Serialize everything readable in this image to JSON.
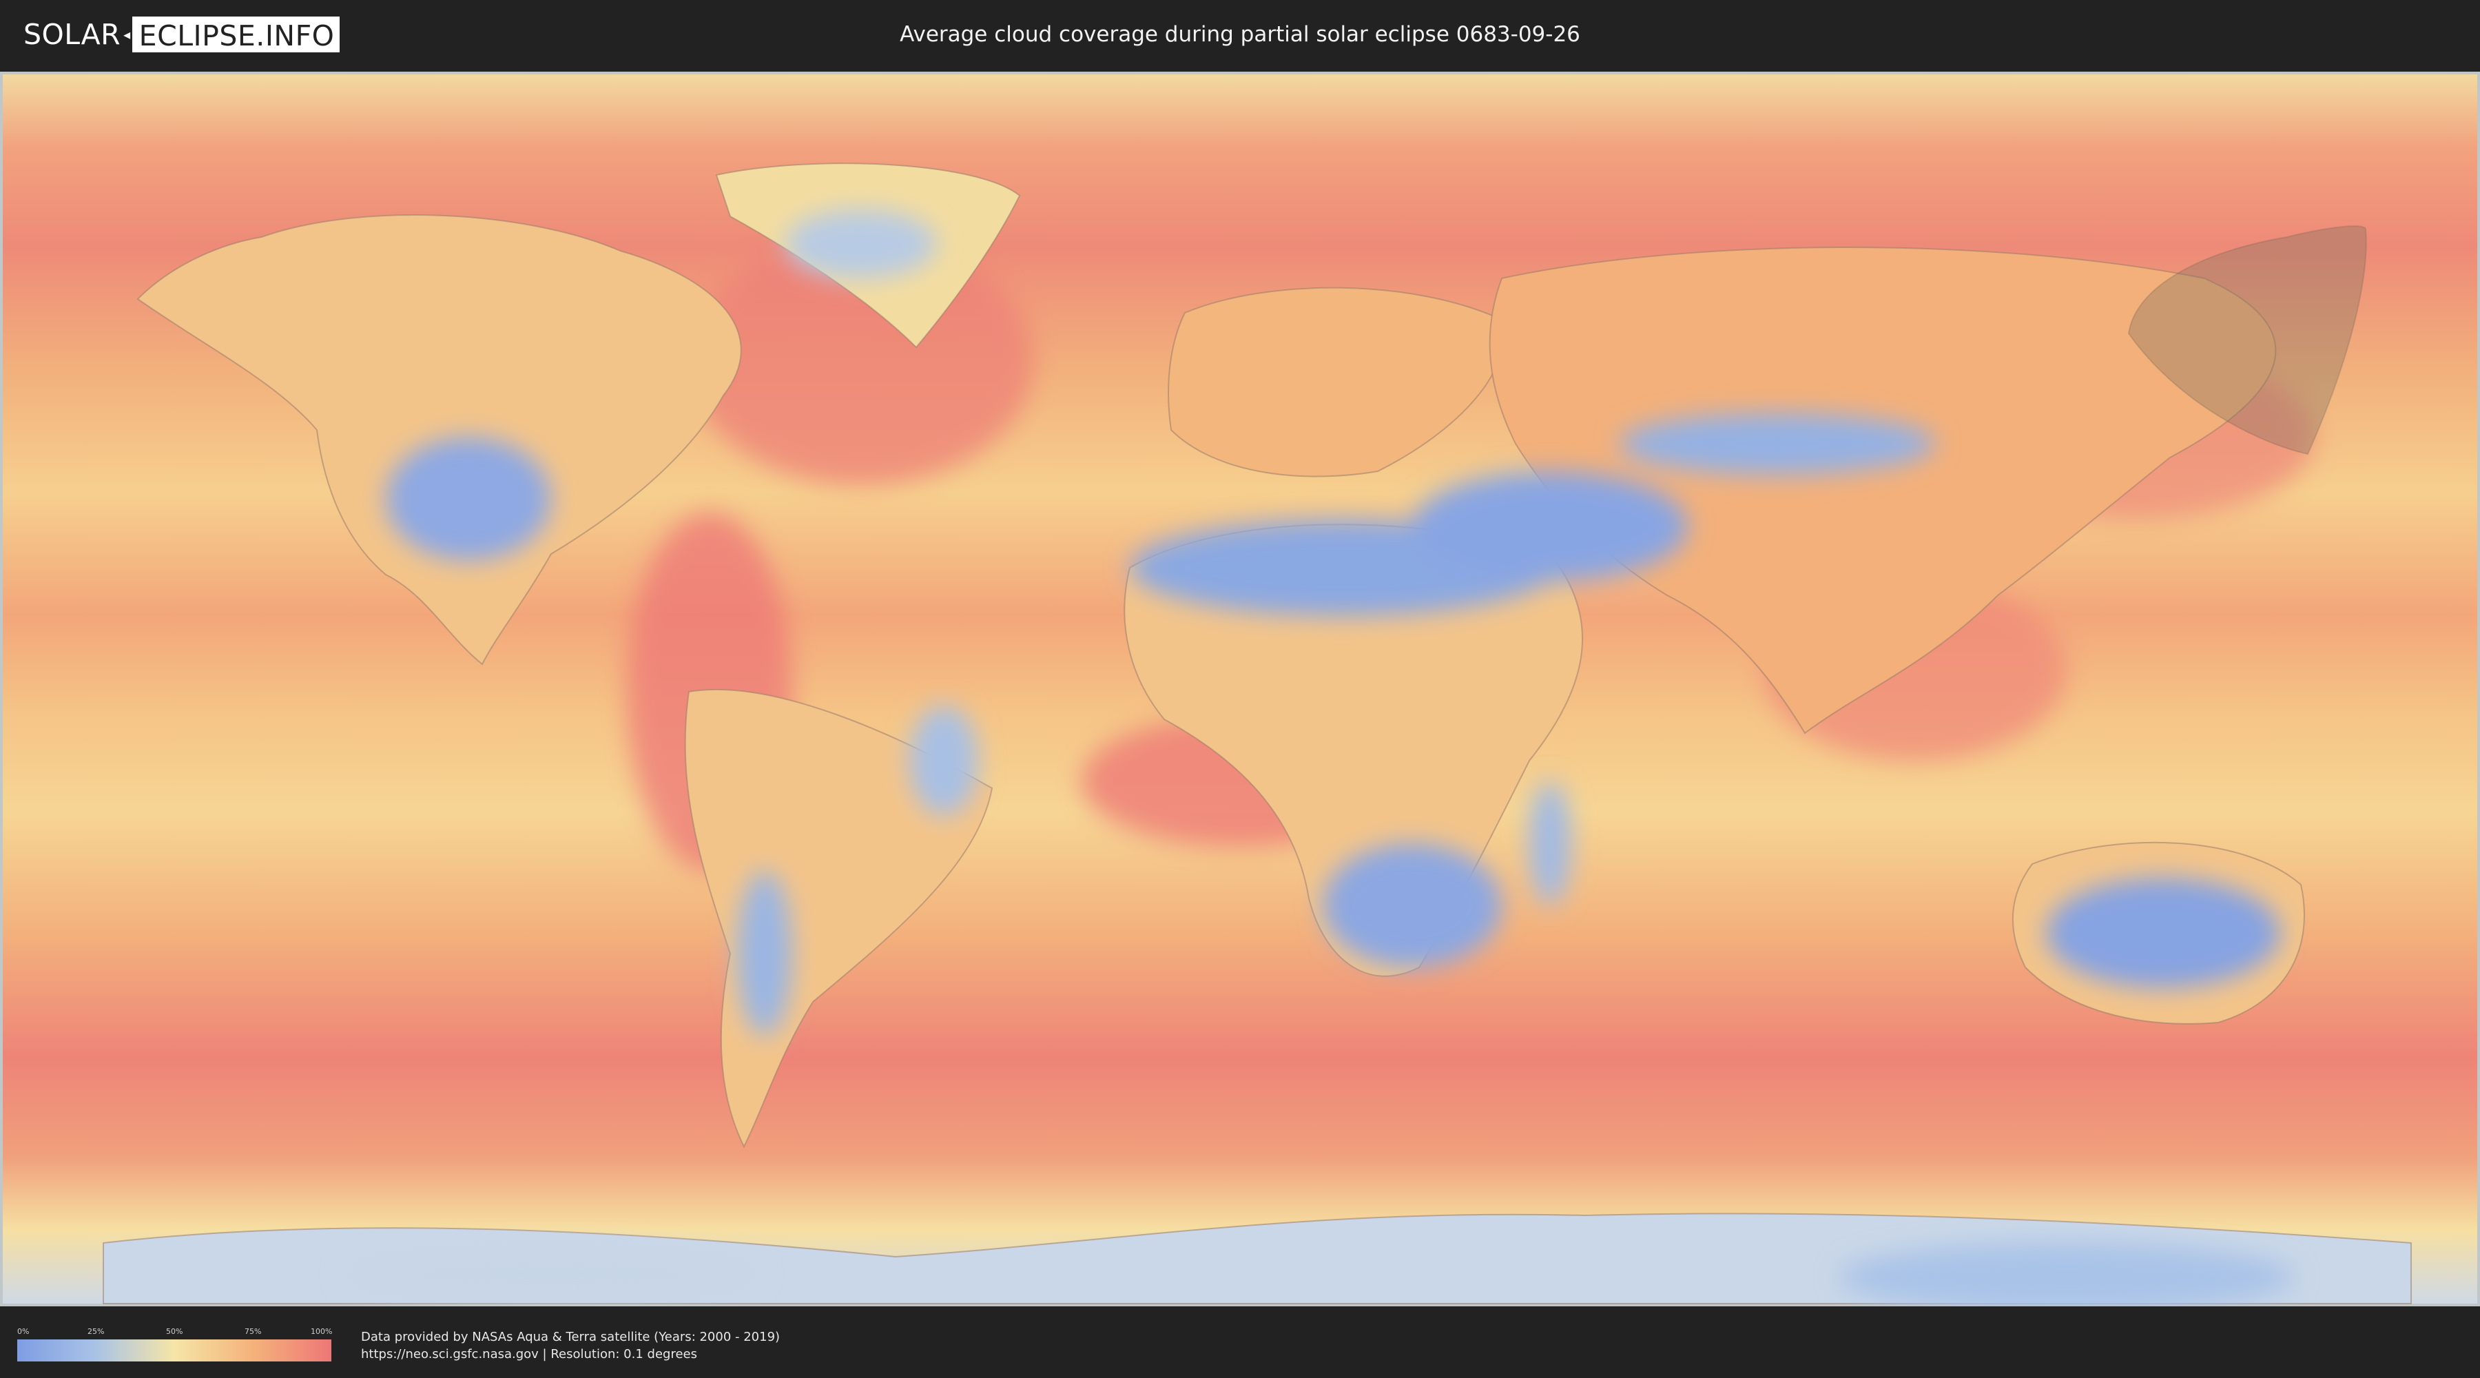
{
  "header": {
    "logo_left": "SOLAR",
    "logo_right": "ECLIPSE.INFO",
    "title": "Average cloud coverage during partial solar eclipse 0683-09-26"
  },
  "map": {
    "colors": {
      "clear": "#7e9de3",
      "low": "#a9c3e6",
      "medium": "#f5e5a7",
      "high": "#f4b27a",
      "overcast": "#ee7777",
      "eclipse_zone": "#7f6f5f"
    }
  },
  "legend": {
    "ticks": [
      "0%",
      "25%",
      "50%",
      "75%",
      "100%"
    ]
  },
  "footer": {
    "credit_line1": "Data provided by NASAs Aqua & Terra satellite (Years: 2000 - 2019)",
    "credit_line2": "https://neo.sci.gsfc.nasa.gov | Resolution: 0.1 degrees"
  }
}
